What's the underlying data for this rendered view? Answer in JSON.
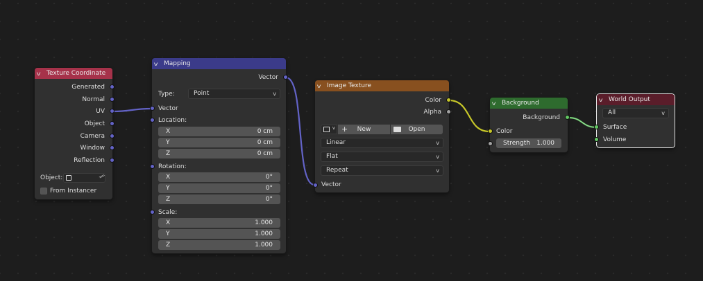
{
  "colors": {
    "background": "#1d1d1d",
    "node_body": "#303030",
    "header_texture_coordinate": "#a6324a",
    "header_mapping": "#3b3b8a",
    "header_image_texture": "#88501f",
    "header_background": "#2e6b2e",
    "header_world_output": "#5a1d2a",
    "socket_vector": "#6363c7",
    "socket_color": "#c7c729",
    "socket_float": "#a1a1a1",
    "socket_shader": "#63c763"
  },
  "nodes": {
    "texture_coordinate": {
      "title": "Texture Coordinate",
      "outputs": [
        "Generated",
        "Normal",
        "UV",
        "Object",
        "Camera",
        "Window",
        "Reflection"
      ],
      "object_label": "Object:",
      "from_instancer": "From Instancer"
    },
    "mapping": {
      "title": "Mapping",
      "output": "Vector",
      "type_label": "Type:",
      "type_value": "Point",
      "vector_label": "Vector",
      "location_label": "Location:",
      "location": [
        {
          "axis": "X",
          "value": "0 cm"
        },
        {
          "axis": "Y",
          "value": "0 cm"
        },
        {
          "axis": "Z",
          "value": "0 cm"
        }
      ],
      "rotation_label": "Rotation:",
      "rotation": [
        {
          "axis": "X",
          "value": "0°"
        },
        {
          "axis": "Y",
          "value": "0°"
        },
        {
          "axis": "Z",
          "value": "0°"
        }
      ],
      "scale_label": "Scale:",
      "scale": [
        {
          "axis": "X",
          "value": "1.000"
        },
        {
          "axis": "Y",
          "value": "1.000"
        },
        {
          "axis": "Z",
          "value": "1.000"
        }
      ]
    },
    "image_texture": {
      "title": "Image Texture",
      "output_color": "Color",
      "output_alpha": "Alpha",
      "new_label": "New",
      "open_label": "Open",
      "interpolation": "Linear",
      "projection": "Flat",
      "extension": "Repeat",
      "vector_label": "Vector"
    },
    "background": {
      "title": "Background",
      "output": "Background",
      "color_label": "Color",
      "strength_label": "Strength",
      "strength_value": "1.000"
    },
    "world_output": {
      "title": "World Output",
      "target": "All",
      "surface_label": "Surface",
      "volume_label": "Volume"
    }
  }
}
